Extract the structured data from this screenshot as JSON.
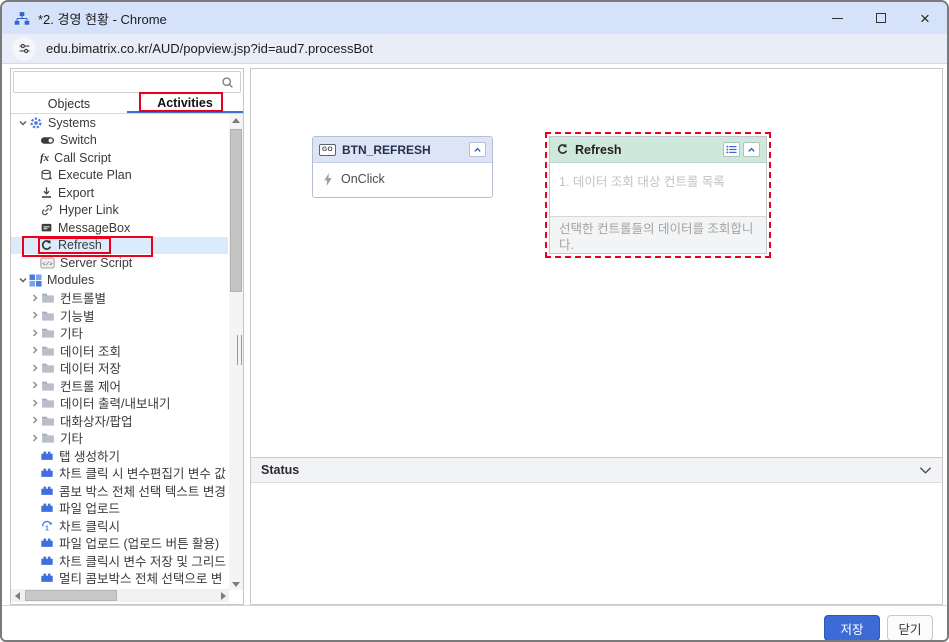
{
  "window": {
    "title": "*2. 경영 현황 - Chrome"
  },
  "browser": {
    "url": "edu.bimatrix.co.kr/AUD/popview.jsp?id=aud7.processBot"
  },
  "sidebar": {
    "search": {
      "value": "",
      "placeholder": ""
    },
    "tabs": [
      {
        "label": "Objects",
        "active": false
      },
      {
        "label": "Activities",
        "active": true,
        "annotated": true
      }
    ],
    "tree": [
      {
        "label": "Systems",
        "icon": "gear-icon",
        "depth": 0,
        "expander": "expanded"
      },
      {
        "label": "Switch",
        "icon": "switch-icon",
        "depth": 1
      },
      {
        "label": "Call Script",
        "icon": "call-script-icon",
        "depth": 1
      },
      {
        "label": "Execute Plan",
        "icon": "execute-plan-icon",
        "depth": 1
      },
      {
        "label": "Export",
        "icon": "export-icon",
        "depth": 1
      },
      {
        "label": "Hyper Link",
        "icon": "hyperlink-icon",
        "depth": 1
      },
      {
        "label": "MessageBox",
        "icon": "messagebox-icon",
        "depth": 1
      },
      {
        "label": "Refresh",
        "icon": "refresh-icon",
        "depth": 1,
        "selected": true,
        "annotated": true
      },
      {
        "label": "Server Script",
        "icon": "server-script-icon",
        "depth": 1
      },
      {
        "label": "Modules",
        "icon": "modules-icon",
        "depth": 0,
        "expander": "expanded"
      },
      {
        "label": "컨트롤별",
        "icon": "folder-icon",
        "depth": 1,
        "expander": "collapsed"
      },
      {
        "label": "기능별",
        "icon": "folder-icon",
        "depth": 1,
        "expander": "collapsed"
      },
      {
        "label": "기타",
        "icon": "folder-icon",
        "depth": 1,
        "expander": "collapsed"
      },
      {
        "label": "데이터 조회",
        "icon": "folder-icon",
        "depth": 1,
        "expander": "collapsed"
      },
      {
        "label": "데이터 저장",
        "icon": "folder-icon",
        "depth": 1,
        "expander": "collapsed"
      },
      {
        "label": "컨트롤 제어",
        "icon": "folder-icon",
        "depth": 1,
        "expander": "collapsed"
      },
      {
        "label": "데이터 출력/내보내기",
        "icon": "folder-icon",
        "depth": 1,
        "expander": "collapsed"
      },
      {
        "label": "대화상자/팝업",
        "icon": "folder-icon",
        "depth": 1,
        "expander": "collapsed"
      },
      {
        "label": "기타",
        "icon": "folder-icon",
        "depth": 1,
        "expander": "collapsed"
      },
      {
        "label": "탭 생성하기",
        "icon": "module-icon",
        "depth": 1
      },
      {
        "label": "차트 클릭 시 변수편집기 변수 값",
        "icon": "module-icon",
        "depth": 1
      },
      {
        "label": "콤보 박스 전체 선택 텍스트 변경",
        "icon": "module-icon",
        "depth": 1
      },
      {
        "label": "파일 업로드",
        "icon": "module-icon",
        "depth": 1
      },
      {
        "label": "차트 클릭시",
        "icon": "repeat-1-icon",
        "depth": 1
      },
      {
        "label": "파일 업로드 (업로드 버튼 활용)",
        "icon": "module-icon",
        "depth": 1
      },
      {
        "label": "차트 클릭시 변수 저장 및 그리드",
        "icon": "module-icon",
        "depth": 1
      },
      {
        "label": "멀티 콤보박스 전체 선택으로 변",
        "icon": "module-icon",
        "depth": 1
      }
    ]
  },
  "canvas": {
    "btn_node": {
      "icon_label": "GO",
      "title": "BTN_REFRESH",
      "event": "OnClick"
    },
    "refresh_node": {
      "title": "Refresh",
      "input_hint": "1. 데이터 조회 대상 컨트롤 목록",
      "description": "선택한 컨트롤들의 데이터를 조회합니다."
    }
  },
  "status": {
    "label": "Status"
  },
  "footer": {
    "save_label": "저장",
    "close_label": "닫기"
  },
  "colors": {
    "titlebar_blue": "#d5e2fa",
    "urlbar_blue": "#e8edf8",
    "accent_blue": "#3f6fd4",
    "annotation_red": "#e8001c",
    "node_header_blue": "#dde4f6",
    "node_header_green": "#cfe8dc",
    "selected_row_blue": "#dcebfb",
    "save_button_blue": "#3d6bd6"
  }
}
